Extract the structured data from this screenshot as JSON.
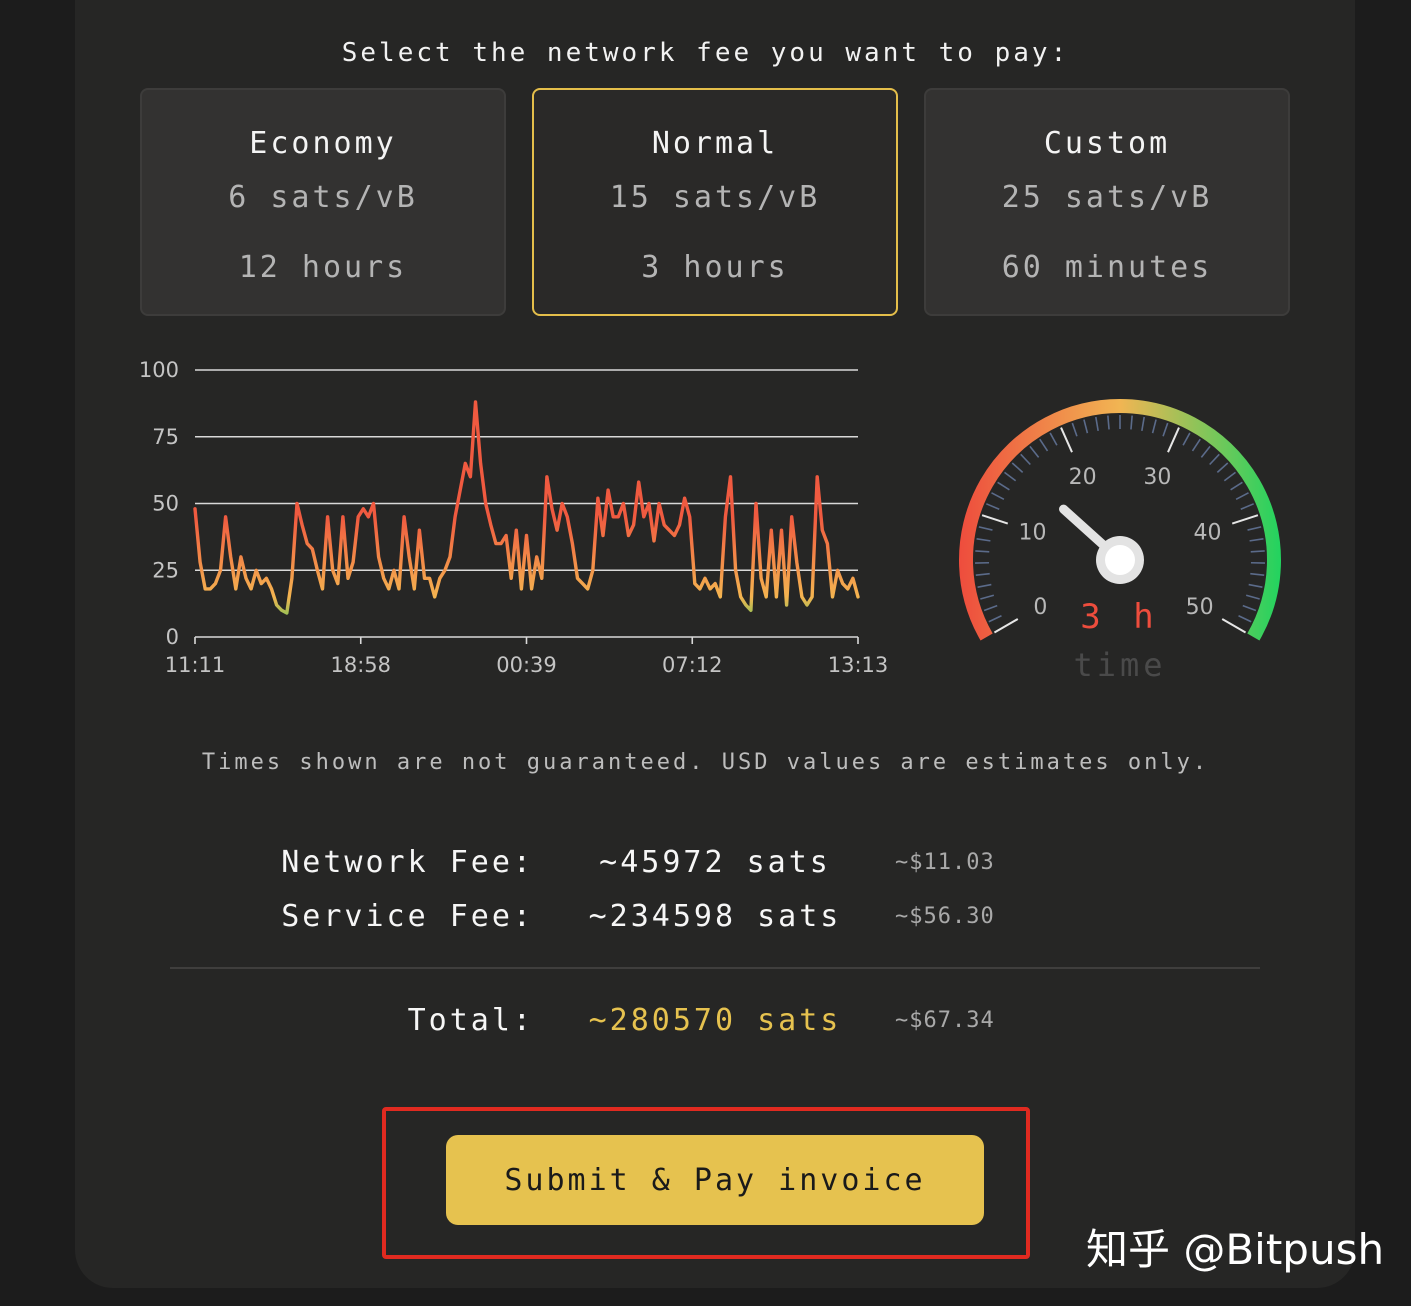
{
  "header": {
    "title": "Select the network fee you want to pay:"
  },
  "fee_options": [
    {
      "name": "Economy",
      "rate": "6 sats/vB",
      "time": "12 hours",
      "selected": false
    },
    {
      "name": "Normal",
      "rate": "15 sats/vB",
      "time": "3 hours",
      "selected": true
    },
    {
      "name": "Custom",
      "rate": "25 sats/vB",
      "time": "60 minutes",
      "selected": false
    }
  ],
  "chart_data": {
    "type": "line",
    "title": "",
    "xlabel": "",
    "ylabel": "",
    "ylim": [
      0,
      100
    ],
    "yticks": [
      "0",
      "25",
      "50",
      "75",
      "100"
    ],
    "xticks": [
      "11:11",
      "18:58",
      "00:39",
      "07:12",
      "13:13"
    ],
    "grid": true,
    "color_scale": {
      "low": "#2fd05a",
      "mid": "#f4b450",
      "high": "#f05a40"
    },
    "series": [
      {
        "values": [
          48,
          28,
          18,
          18,
          20,
          25,
          45,
          30,
          18,
          30,
          22,
          18,
          25,
          20,
          22,
          18,
          12,
          10,
          9,
          22,
          50,
          42,
          35,
          33,
          25,
          18,
          45,
          25,
          20,
          45,
          22,
          28,
          45,
          48,
          45,
          50,
          30,
          22,
          18,
          25,
          18,
          45,
          30,
          18,
          40,
          22,
          22,
          15,
          22,
          25,
          30,
          45,
          55,
          65,
          60,
          88,
          65,
          50,
          42,
          35,
          35,
          38,
          22,
          40,
          18,
          38,
          18,
          30,
          22,
          60,
          48,
          40,
          50,
          45,
          35,
          22,
          20,
          18,
          25,
          52,
          38,
          55,
          45,
          45,
          50,
          38,
          42,
          58,
          45,
          50,
          36,
          50,
          42,
          40,
          38,
          42,
          52,
          45,
          20,
          18,
          22,
          18,
          20,
          15,
          45,
          60,
          25,
          15,
          12,
          10,
          50,
          22,
          15,
          40,
          15,
          40,
          12,
          45,
          28,
          15,
          12,
          15,
          60,
          40,
          35,
          15,
          25,
          20,
          18,
          22,
          15
        ]
      }
    ]
  },
  "gauge": {
    "value": 15,
    "min": 0,
    "max": 50,
    "tick_labels": [
      "0",
      "10",
      "20",
      "30",
      "40",
      "50"
    ],
    "readout": "3 h",
    "caption": "time",
    "colors": {
      "low": "#ee4d3d",
      "mid": "#f1b553",
      "high": "#23d35f"
    }
  },
  "disclaimer": "Times shown are not guaranteed. USD values are estimates only.",
  "fees": {
    "network": {
      "label": "Network Fee:",
      "sats": "~45972 sats",
      "usd": "~$11.03"
    },
    "service": {
      "label": "Service Fee:",
      "sats": "~234598 sats",
      "usd": "~$56.30"
    },
    "total": {
      "label": "Total:",
      "sats": "~280570 sats",
      "usd": "~$67.34",
      "color": "#e6c24f"
    }
  },
  "submit": {
    "label": "Submit & Pay invoice",
    "color": "#e6c24f"
  },
  "highlight": {
    "color": "#e02a20"
  },
  "overlays": {
    "corner_watermark": "知乎 @Bitpush"
  }
}
